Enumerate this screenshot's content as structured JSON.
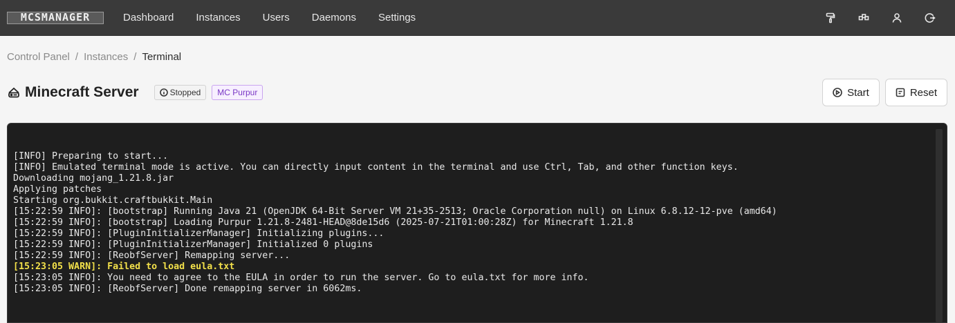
{
  "logo": {
    "text": "MCSMANAGER"
  },
  "nav": [
    {
      "label": "Dashboard"
    },
    {
      "label": "Instances"
    },
    {
      "label": "Users"
    },
    {
      "label": "Daemons"
    },
    {
      "label": "Settings"
    }
  ],
  "top_icons": [
    "paint-roller-icon",
    "layout-icon",
    "user-icon",
    "logout-icon"
  ],
  "breadcrumb": {
    "items": [
      "Control Panel",
      "Instances"
    ],
    "separator": "/",
    "current": "Terminal"
  },
  "instance": {
    "title": "Minecraft Server",
    "status": "Stopped",
    "type": "MC Purpur",
    "type_color": "#7a37c5"
  },
  "actions": {
    "start": "Start",
    "reset": "Reset"
  },
  "terminal": {
    "lines": [
      "[INFO] Preparing to start...",
      "[INFO] Emulated terminal mode is active. You can directly input content in the terminal and use Ctrl, Tab, and other function keys.",
      "Downloading mojang_1.21.8.jar",
      "Applying patches",
      "Starting org.bukkit.craftbukkit.Main",
      "[15:22:59 INFO]: [bootstrap] Running Java 21 (OpenJDK 64-Bit Server VM 21+35-2513; Oracle Corporation null) on Linux 6.8.12-12-pve (amd64)",
      "[15:22:59 INFO]: [bootstrap] Loading Purpur 1.21.8-2481-HEAD@8de15d6 (2025-07-21T01:00:28Z) for Minecraft 1.21.8",
      "[15:22:59 INFO]: [PluginInitializerManager] Initializing plugins...",
      "[15:22:59 INFO]: [PluginInitializerManager] Initialized 0 plugins",
      "[15:22:59 INFO]: [ReobfServer] Remapping server...",
      "[15:23:05 WARN]: Failed to load eula.txt",
      "[15:23:05 INFO]: You need to agree to the EULA in order to run the server. Go to eula.txt for more info.",
      "[15:23:05 INFO]: [ReobfServer] Done remapping server in 6062ms."
    ],
    "warn_color": "#f2e04a"
  }
}
